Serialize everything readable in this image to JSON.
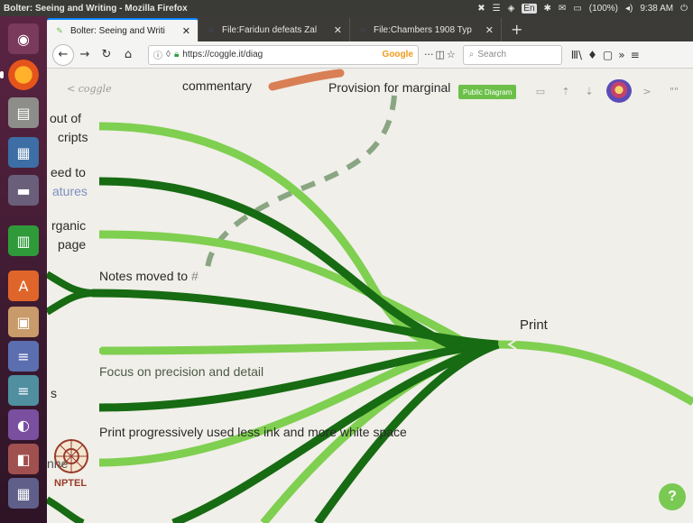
{
  "window": {
    "title": "Bolter: Seeing and Writing - Mozilla Firefox",
    "tray": {
      "battery": "(100%)",
      "time": "9:38 AM",
      "lang": "En"
    }
  },
  "tabs": [
    {
      "label": "Bolter: Seeing and Writi",
      "active": true
    },
    {
      "label": "File:Faridun defeats Zal",
      "active": false
    },
    {
      "label": "File:Chambers 1908 Typ",
      "active": false
    }
  ],
  "navbar": {
    "url": "https://coggle.it/diag",
    "search_engine": "Google",
    "search_placeholder": "Search",
    "more": "···"
  },
  "coggle": {
    "back_label": "< coggle",
    "public_badge": "Public Diagram",
    "next": ">",
    "quote": "\"\"",
    "help": "?"
  },
  "nodes": {
    "commentary": "commentary",
    "marginal": "Provision for marginal",
    "left1a": "out of",
    "left1b": "cripts",
    "left2a": "eed to",
    "left2b": "atures",
    "left3a": "rganic",
    "left3b": "page",
    "notes": "Notes moved to",
    "notes_mark": "#",
    "print": "Print",
    "focus": "Focus on precision and detail",
    "left_s": "s",
    "print_progress": "Print progressively used less ink and more white space"
  },
  "watermark": {
    "logo_text": "NPTEL",
    "side_text": "nne"
  },
  "colors": {
    "light_green": "#7fcf50",
    "dark_green": "#176b12",
    "dashed": "#8aa582",
    "orange": "#d97f55",
    "launcher": "#4a1f38"
  },
  "launcher_icons": [
    "ubuntu-dash-icon",
    "firefox-icon",
    "files-icon",
    "writer-icon",
    "drive-icon",
    "calc-icon",
    "software-center-icon",
    "document-viewer-icon",
    "app-icon-1",
    "app-icon-2",
    "app-icon-3",
    "app-icon-4",
    "app-icon-5"
  ]
}
